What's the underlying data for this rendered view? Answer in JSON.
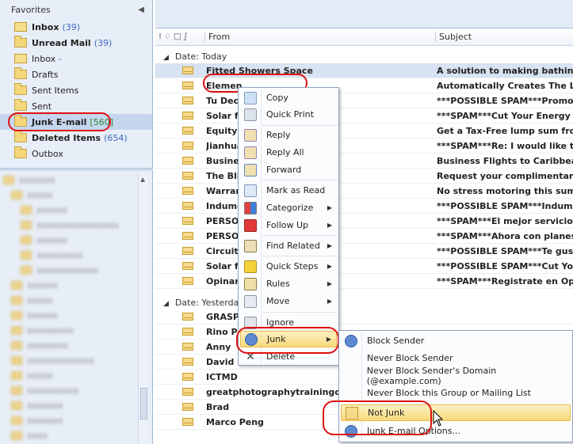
{
  "nav": {
    "favorites_label": "Favorites",
    "items": [
      {
        "label": "Inbox",
        "count": "(39)",
        "bold": true
      },
      {
        "label": "Unread Mail",
        "count": "(39)",
        "bold": true
      },
      {
        "label": "Inbox",
        "count": "-",
        "bold": false
      },
      {
        "label": "Drafts",
        "count": "",
        "bold": false
      },
      {
        "label": "Sent Items",
        "count": "",
        "bold": false
      },
      {
        "label": "Sent",
        "count": "",
        "bold": false
      },
      {
        "label": "Junk E-mail",
        "count": "[560]",
        "bold": true
      },
      {
        "label": "Deleted Items",
        "count": "(654)",
        "bold": false
      },
      {
        "label": "Outbox",
        "count": "",
        "bold": false
      }
    ]
  },
  "list": {
    "columns": {
      "from": "From",
      "subject": "Subject"
    },
    "group_today": "Date: Today",
    "group_yesterday": "Date: Yesterday",
    "today_rows": [
      {
        "from": "Fitted Showers Space",
        "subject": "A solution to making bathing a p"
      },
      {
        "from": "Elemen",
        "subject": "Automatically Creates The Life Yo"
      },
      {
        "from": "Tu Deco",
        "subject": "***POSSIBLE SPAM***Promocion"
      },
      {
        "from": "Solar fo",
        "subject": "***SPAM***Cut Your Energy Bill I"
      },
      {
        "from": "Equity R",
        "subject": "Get a Tax-Free lump sum from yo"
      },
      {
        "from": "Jianhua",
        "subject": "***SPAM***Re: I would like to ma"
      },
      {
        "from": "Busines",
        "subject": "Business Flights to Caribbean and"
      },
      {
        "from": "The Blin",
        "subject": "Request your complimentary Blin"
      },
      {
        "from": "Warran",
        "subject": "No stress motoring this summer"
      },
      {
        "from": "Indume",
        "subject": "***POSSIBLE SPAM***Indumenta"
      },
      {
        "from": "PERSON",
        "subject": "***SPAM***El mejor servicio a Py"
      },
      {
        "from": "PERSON",
        "subject": "***SPAM***Ahora con planes ILI"
      },
      {
        "from": "Circuito",
        "subject": "***POSSIBLE SPAM***Te gustaria"
      },
      {
        "from": "Solar fo",
        "subject": "***POSSIBLE SPAM***Cut Your Er"
      },
      {
        "from": "Opinan",
        "subject": "***SPAM***Registrate en Opinan"
      }
    ],
    "yesterday_rows": [
      {
        "from": "GRASP",
        "subject": ""
      },
      {
        "from": "Rino Pu",
        "subject": ""
      },
      {
        "from": "Anny",
        "subject": ""
      },
      {
        "from": "David B. Henderson",
        "subject": ""
      },
      {
        "from": "ICTMD",
        "subject": ""
      },
      {
        "from": "greatphotographytrainingoptio",
        "subject": ""
      },
      {
        "from": "Brad",
        "subject": ""
      },
      {
        "from": "Marco Peng",
        "subject": ""
      }
    ]
  },
  "context_menu": {
    "items": [
      "Copy",
      "Quick Print",
      "Reply",
      "Reply All",
      "Forward",
      "Mark as Read",
      "Categorize",
      "Follow Up",
      "Find Related",
      "Quick Steps",
      "Rules",
      "Move",
      "Ignore",
      "Junk",
      "Delete"
    ]
  },
  "junk_submenu": {
    "items": [
      "Block Sender",
      "Never Block Sender",
      "Never Block Sender's Domain (@example.com)",
      "Never Block this Group or Mailing List",
      "Not Junk",
      "Junk E-mail Options..."
    ]
  },
  "colors": {
    "highlight": "#f8d97c",
    "annotation": "#e01010",
    "nav_bg": "#e8eef7"
  }
}
